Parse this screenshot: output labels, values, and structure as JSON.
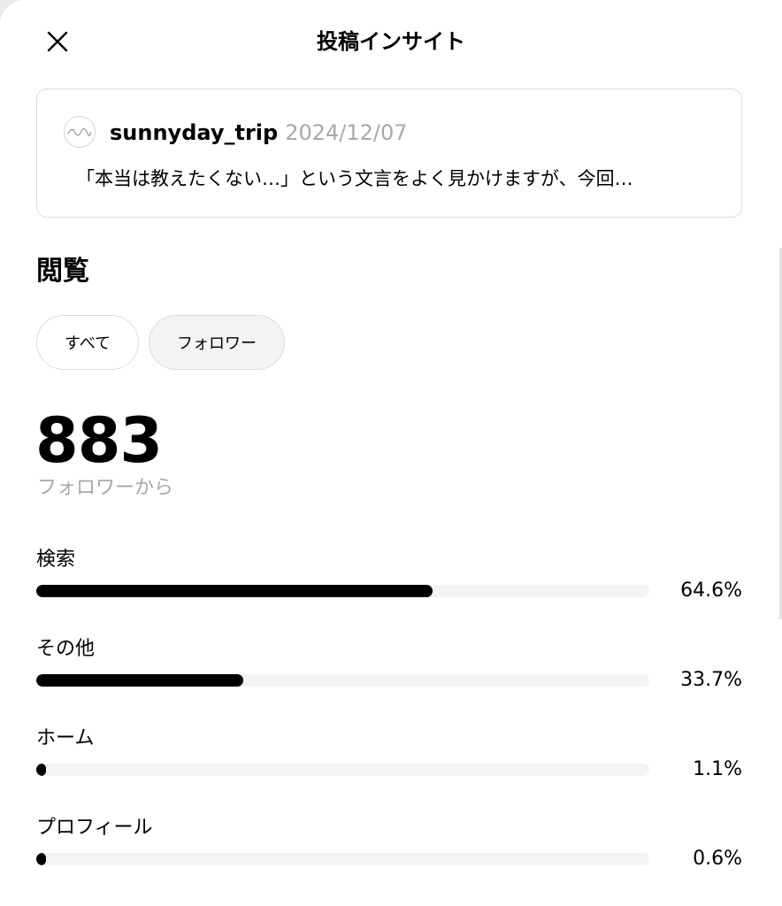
{
  "header": {
    "title": "投稿インサイト"
  },
  "post": {
    "username": "sunnyday_trip",
    "date": "2024/12/07",
    "text": "「本当は教えたくない…」という文言をよく見かけますが、今回…"
  },
  "views": {
    "section_title": "閲覧",
    "filters": [
      "すべて",
      "フォロワー"
    ],
    "selected_filter": "フォロワー",
    "count": "883",
    "caption": "フォロワーから"
  },
  "sources": [
    {
      "label": "検索",
      "percent_text": "64.6%",
      "value": 64.6
    },
    {
      "label": "その他",
      "percent_text": "33.7%",
      "value": 33.7
    },
    {
      "label": "ホーム",
      "percent_text": "1.1%",
      "value": 1.1
    },
    {
      "label": "プロフィール",
      "percent_text": "0.6%",
      "value": 0.6
    }
  ],
  "colors": {
    "bar_fill": "#000000",
    "bar_track": "#f4f4f4",
    "muted_text": "#a8a8a8",
    "border": "#dcdcdc"
  },
  "icons": {
    "close": "close-icon",
    "avatar": "avatar-logo"
  },
  "scale": {
    "max_percent": 100
  }
}
